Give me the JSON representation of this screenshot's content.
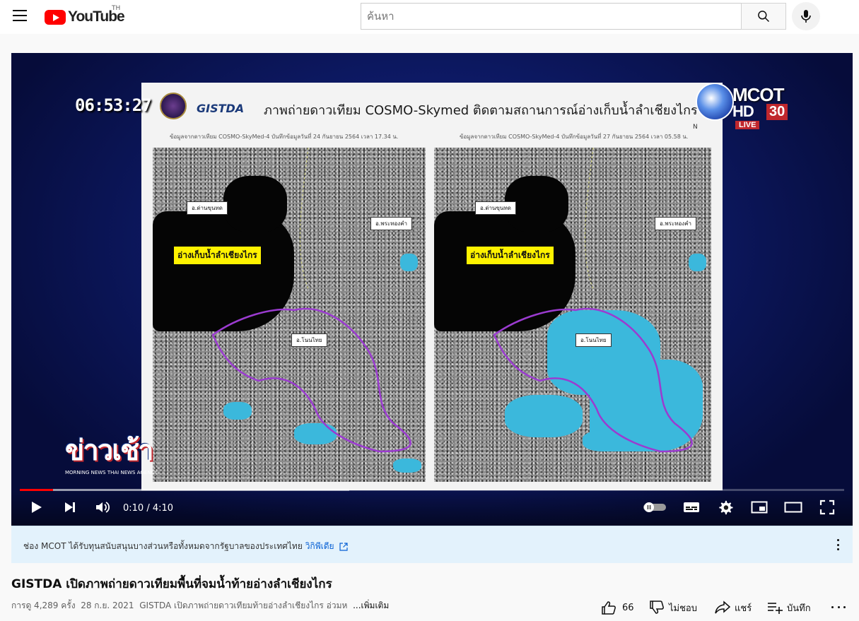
{
  "header": {
    "logo_text": "YouTube",
    "country_code": "TH",
    "search_placeholder": "ค้นหา"
  },
  "video_frame": {
    "timestamp": "06:53:27",
    "slide_title": "ภาพถ่ายดาวเทียม COSMO-Skymed  ติดตามสถานการณ์อ่างเก็บน้ำลำเชียงไกร",
    "gistda_logo": "GISTDA",
    "caption_left": "ข้อมูลจากดาวเทียม COSMO-SkyMed-4 บันทึกข้อมูลวันที่ 24 กันยายน 2564 เวลา 17.34 น.",
    "caption_right": "ข้อมูลจากดาวเทียม COSMO-SkyMed-4 บันทึกข้อมูลวันที่ 27 กันยายน 2564 เวลา 05.58 น.",
    "north_label": "N",
    "label_district_1": "อ.ด่านขุนทด",
    "label_district_2": "อ.พระทองคำ",
    "label_district_3": "อ.โนนไทย",
    "label_reservoir": "อ่างเก็บน้ำลำเชียงไกร",
    "channel_logo": "MCOT",
    "channel_hd": "HD",
    "channel_number": "30",
    "live_label": "LIVE",
    "program_logo": "ข่าวเช้า",
    "program_sub": "MORNING NEWS THAI NEWS AGENCY"
  },
  "player": {
    "current_time": "0:10",
    "duration": "4:10",
    "time_display": "0:10 / 4:10",
    "played_fraction": 0.04,
    "buffered_fraction": 0.4
  },
  "info_banner": {
    "text": "ช่อง MCOT ได้รับทุนสนับสนุนบางส่วนหรือทั้งหมดจากรัฐบาลของประเทศไทย",
    "link_text": "วิกิพีเดีย"
  },
  "video": {
    "title": "GISTDA เปิดภาพถ่ายดาวเทียมพื้นที่จมน้ำท้ายอ่างลำเชียงไกร",
    "views": "การดู 4,289 ครั้ง",
    "date": "28 ก.ย. 2021",
    "description_snippet": "GISTDA เปิดภาพถ่ายดาวเทียมท้ายอ่างลำเชียงไกร อ่วมห",
    "more_label": "...เพิ่มเติม"
  },
  "actions": {
    "like_count": "66",
    "dislike_label": "ไม่ชอบ",
    "share_label": "แชร์",
    "save_label": "บันทึก"
  },
  "colors": {
    "brand_red": "#ff0000",
    "link_blue": "#065fd4",
    "banner_bg": "#e3f2fc",
    "water_cyan": "#3bb8dc"
  }
}
